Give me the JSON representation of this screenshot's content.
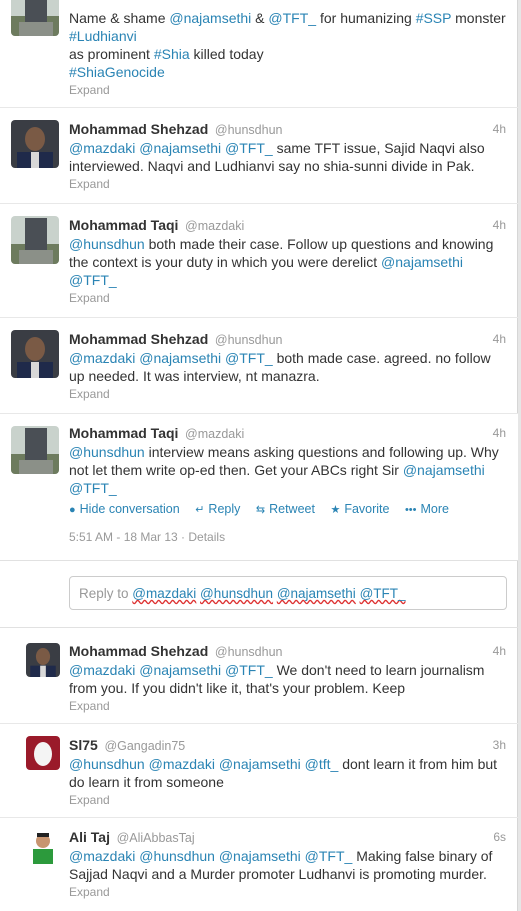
{
  "tweets": [
    {
      "fullname": "",
      "username": "",
      "time": "",
      "text_parts": [
        [
          "t",
          "Name & shame "
        ],
        [
          "m",
          "@najamsethi"
        ],
        [
          "t",
          " & "
        ],
        [
          "m",
          "@TFT_"
        ],
        [
          "t",
          " for humanizing "
        ],
        [
          "h",
          "#SSP"
        ],
        [
          "t",
          " monster "
        ],
        [
          "br",
          ""
        ],
        [
          "h",
          "#Ludhianvi"
        ],
        [
          "br",
          ""
        ],
        [
          "t",
          "as prominent "
        ],
        [
          "h",
          "#Shia"
        ],
        [
          "t",
          " killed today"
        ],
        [
          "br",
          ""
        ],
        [
          "h",
          "#ShiaGenocide"
        ]
      ],
      "expand": "Expand"
    },
    {
      "fullname": "Mohammad Shehzad",
      "username": "@hunsdhun",
      "time": "4h",
      "text_parts": [
        [
          "m",
          "@mazdaki"
        ],
        [
          "t",
          " "
        ],
        [
          "m",
          "@najamsethi"
        ],
        [
          "t",
          " "
        ],
        [
          "m",
          "@TFT_"
        ],
        [
          "t",
          "  same TFT issue, Sajid Naqvi also interviewed. Naqvi and Ludhianvi say no shia-sunni divide in Pak."
        ]
      ],
      "expand": "Expand"
    },
    {
      "fullname": "Mohammad Taqi",
      "username": "@mazdaki",
      "time": "4h",
      "text_parts": [
        [
          "m",
          "@hunsdhun"
        ],
        [
          "t",
          " both made their case. Follow up questions and knowing the context is your duty in which you were derelict "
        ],
        [
          "m",
          "@najamsethi"
        ],
        [
          "t",
          " "
        ],
        [
          "m",
          "@TFT_"
        ]
      ],
      "expand": "Expand"
    },
    {
      "fullname": "Mohammad Shehzad",
      "username": "@hunsdhun",
      "time": "4h",
      "text_parts": [
        [
          "m",
          "@mazdaki"
        ],
        [
          "t",
          " "
        ],
        [
          "m",
          "@najamsethi"
        ],
        [
          "t",
          " "
        ],
        [
          "m",
          "@TFT_"
        ],
        [
          "t",
          "  both made case. agreed. no follow up needed. It was interview, nt manazra."
        ]
      ],
      "expand": "Expand"
    },
    {
      "fullname": "Mohammad Taqi",
      "username": "@mazdaki",
      "time": "4h",
      "text_parts": [
        [
          "m",
          "@hunsdhun"
        ],
        [
          "t",
          " interview means asking questions and following up. Why not let them write op-ed then. Get your ABCs right Sir "
        ],
        [
          "m",
          "@najamsethi"
        ],
        [
          "t",
          " "
        ],
        [
          "m",
          "@TFT_"
        ]
      ],
      "actions": {
        "hide": "Hide conversation",
        "reply": "Reply",
        "retweet": "Retweet",
        "favorite": "Favorite",
        "more": "More"
      },
      "meta": "5:51 AM - 18 Mar 13 · Details"
    }
  ],
  "reply_box": {
    "prefix": "Reply to ",
    "mentions": [
      "@mazdaki",
      "@hunsdhun",
      "@najamsethi",
      "@TFT_"
    ]
  },
  "replies": [
    {
      "fullname": "Mohammad Shehzad",
      "username": "@hunsdhun",
      "time": "4h",
      "text_parts": [
        [
          "m",
          "@mazdaki"
        ],
        [
          "t",
          " "
        ],
        [
          "m",
          "@najamsethi"
        ],
        [
          "t",
          " "
        ],
        [
          "m",
          "@TFT_"
        ],
        [
          "t",
          "  We don't need to learn journalism from you. If you didn't like it, that's your problem. Keep"
        ]
      ],
      "expand": "Expand"
    },
    {
      "fullname": "Sl75",
      "username": "@Gangadin75",
      "time": "3h",
      "text_parts": [
        [
          "m",
          "@hunsdhun"
        ],
        [
          "t",
          " "
        ],
        [
          "m",
          "@mazdaki"
        ],
        [
          "t",
          " "
        ],
        [
          "m",
          "@najamsethi"
        ],
        [
          "t",
          " "
        ],
        [
          "m",
          "@tft_"
        ],
        [
          "t",
          " dont learn it from him but do learn it from someone"
        ]
      ],
      "expand": "Expand"
    },
    {
      "fullname": "Ali Taj",
      "username": "@AliAbbasTaj",
      "time": "6s",
      "text_parts": [
        [
          "m",
          "@mazdaki"
        ],
        [
          "t",
          " "
        ],
        [
          "m",
          "@hunsdhun"
        ],
        [
          "t",
          " "
        ],
        [
          "m",
          "@najamsethi"
        ],
        [
          "t",
          " "
        ],
        [
          "m",
          "@TFT_"
        ],
        [
          "t",
          "   Making false binary of Sajjad Naqvi and a Murder promoter Ludhanvi is promoting murder."
        ]
      ],
      "expand": "Expand"
    }
  ]
}
